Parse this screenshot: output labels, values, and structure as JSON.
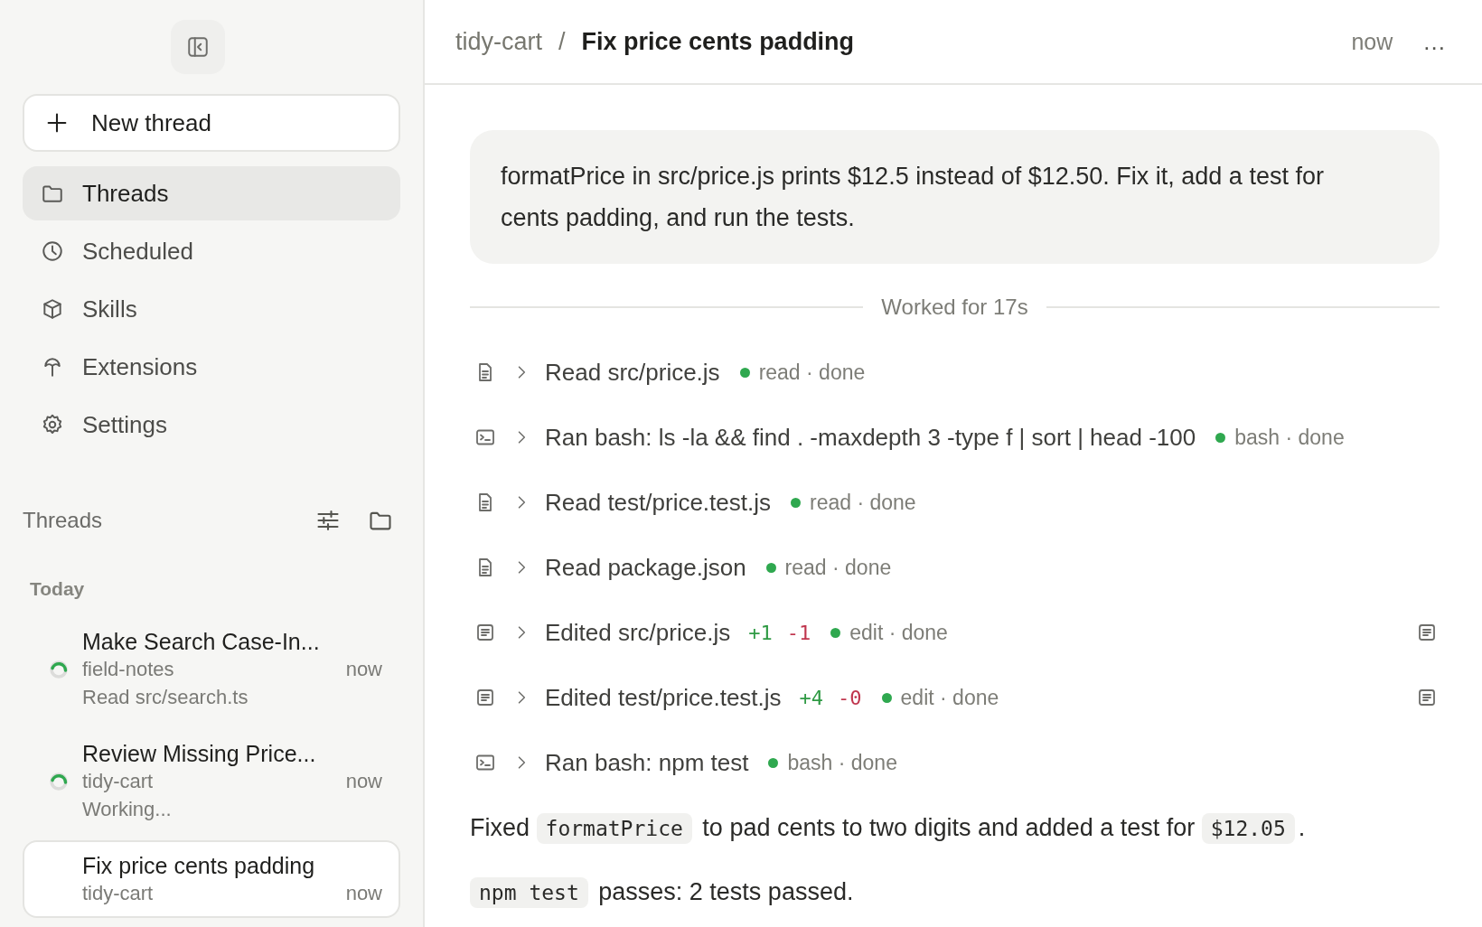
{
  "sidebar": {
    "new_thread": "New thread",
    "nav": [
      {
        "label": "Threads",
        "selected": true
      },
      {
        "label": "Scheduled",
        "selected": false
      },
      {
        "label": "Skills",
        "selected": false
      },
      {
        "label": "Extensions",
        "selected": false
      },
      {
        "label": "Settings",
        "selected": false
      }
    ],
    "section_title": "Threads",
    "group": "Today",
    "threads": [
      {
        "title": "Make Search Case-In...",
        "project": "field-notes",
        "time": "now",
        "preview": "Read src/search.ts",
        "running": true,
        "selected": false
      },
      {
        "title": "Review Missing Price...",
        "project": "tidy-cart",
        "time": "now",
        "preview": "Working...",
        "running": true,
        "selected": false
      },
      {
        "title": "Fix price cents padding",
        "project": "tidy-cart",
        "time": "now",
        "running": false,
        "selected": true
      }
    ]
  },
  "header": {
    "project": "tidy-cart",
    "separator": "/",
    "title": "Fix price cents padding",
    "time": "now",
    "menu": "..."
  },
  "prompt": "formatPrice in src/price.js prints $12.5 instead of $12.50. Fix it, add a test for cents padding, and run the tests.",
  "worked": "Worked for 17s",
  "steps": [
    {
      "kind": "read",
      "label": "Read src/price.js",
      "status": "read · done"
    },
    {
      "kind": "bash",
      "label": "Ran bash: ls -la && find . -maxdepth 3 -type f | sort | head -100",
      "status": "bash · done"
    },
    {
      "kind": "read",
      "label": "Read test/price.test.js",
      "status": "read · done"
    },
    {
      "kind": "read",
      "label": "Read package.json",
      "status": "read · done"
    },
    {
      "kind": "edit",
      "label": "Edited src/price.js",
      "added": "+1",
      "removed": "-1",
      "status": "edit · done"
    },
    {
      "kind": "edit",
      "label": "Edited test/price.test.js",
      "added": "+4",
      "removed": "-0",
      "status": "edit · done"
    },
    {
      "kind": "bash",
      "label": "Ran bash: npm test",
      "status": "bash · done"
    }
  ],
  "reply": [
    [
      {
        "kind": "text",
        "text": "Fixed "
      },
      {
        "kind": "code",
        "text": "formatPrice"
      },
      {
        "kind": "text",
        "text": " to pad cents to two digits and added a test for "
      },
      {
        "kind": "code",
        "text": "$12.05"
      },
      {
        "kind": "text",
        "text": "."
      }
    ],
    [
      {
        "kind": "code",
        "text": "npm test"
      },
      {
        "kind": "text",
        "text": " passes: 2 tests passed."
      }
    ]
  ]
}
